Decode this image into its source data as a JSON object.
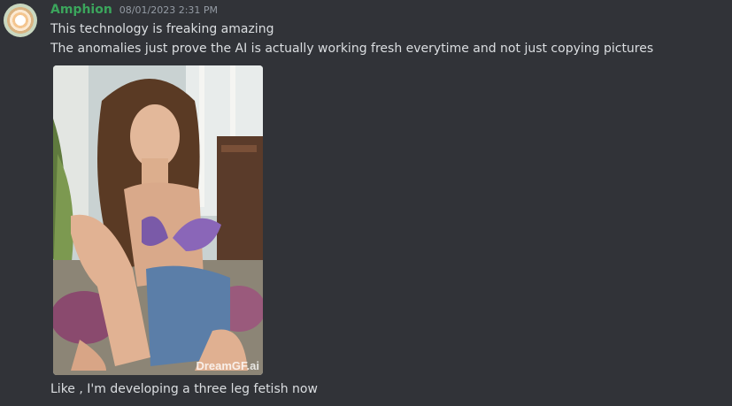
{
  "message": {
    "author": "Amphion",
    "timestamp": "08/01/2023 2:31 PM",
    "lines": [
      "This technology is freaking amazing",
      "The anomalies just prove the AI is actually working fresh everytime and not just copying pictures",
      "Like , I'm developing a three leg fetish now"
    ],
    "attachment": {
      "watermark": "DreamGF.ai"
    }
  },
  "colors": {
    "background": "#313338",
    "username": "#3ba55c",
    "text": "#dbdee1",
    "timestamp": "#949ba4"
  }
}
